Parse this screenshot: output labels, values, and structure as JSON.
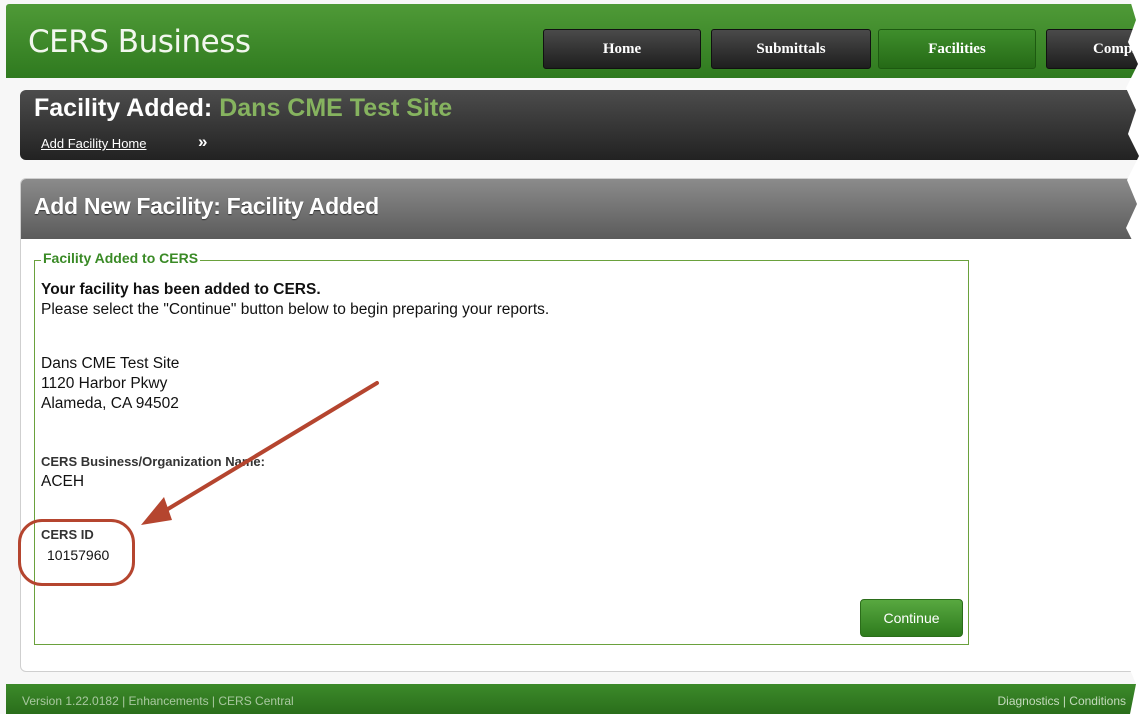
{
  "app": {
    "title": "CERS Business"
  },
  "nav": {
    "items": [
      {
        "label": "Home",
        "active": false
      },
      {
        "label": "Submittals",
        "active": false
      },
      {
        "label": "Facilities",
        "active": true
      },
      {
        "label": "Complia",
        "active": false
      }
    ]
  },
  "header": {
    "title_prefix": "Facility Added:",
    "title_site": "Dans CME Test Site",
    "breadcrumb_link": "Add Facility Home",
    "breadcrumb_sep": "»"
  },
  "panel": {
    "title": "Add New Facility: Facility Added",
    "legend": "Facility Added to CERS",
    "success_title": "Your facility has been added to CERS.",
    "instruction": "Please select the \"Continue\" button below to begin preparing your reports.",
    "address": {
      "name": "Dans CME Test Site",
      "street": "1120 Harbor Pkwy",
      "city": "Alameda, CA 94502"
    },
    "org_label": "CERS Business/Organization Name:",
    "org_value": "ACEH",
    "cers_id_label": "CERS ID",
    "cers_id_value": "10157960",
    "continue_label": "Continue"
  },
  "footer": {
    "left": "Version 1.22.0182 | Enhancements | CERS Central",
    "right": "Diagnostics | Conditions"
  },
  "colors": {
    "brand_green": "#2f7a1f",
    "site_green": "#86b35f",
    "annotation_red": "#b5452f"
  }
}
